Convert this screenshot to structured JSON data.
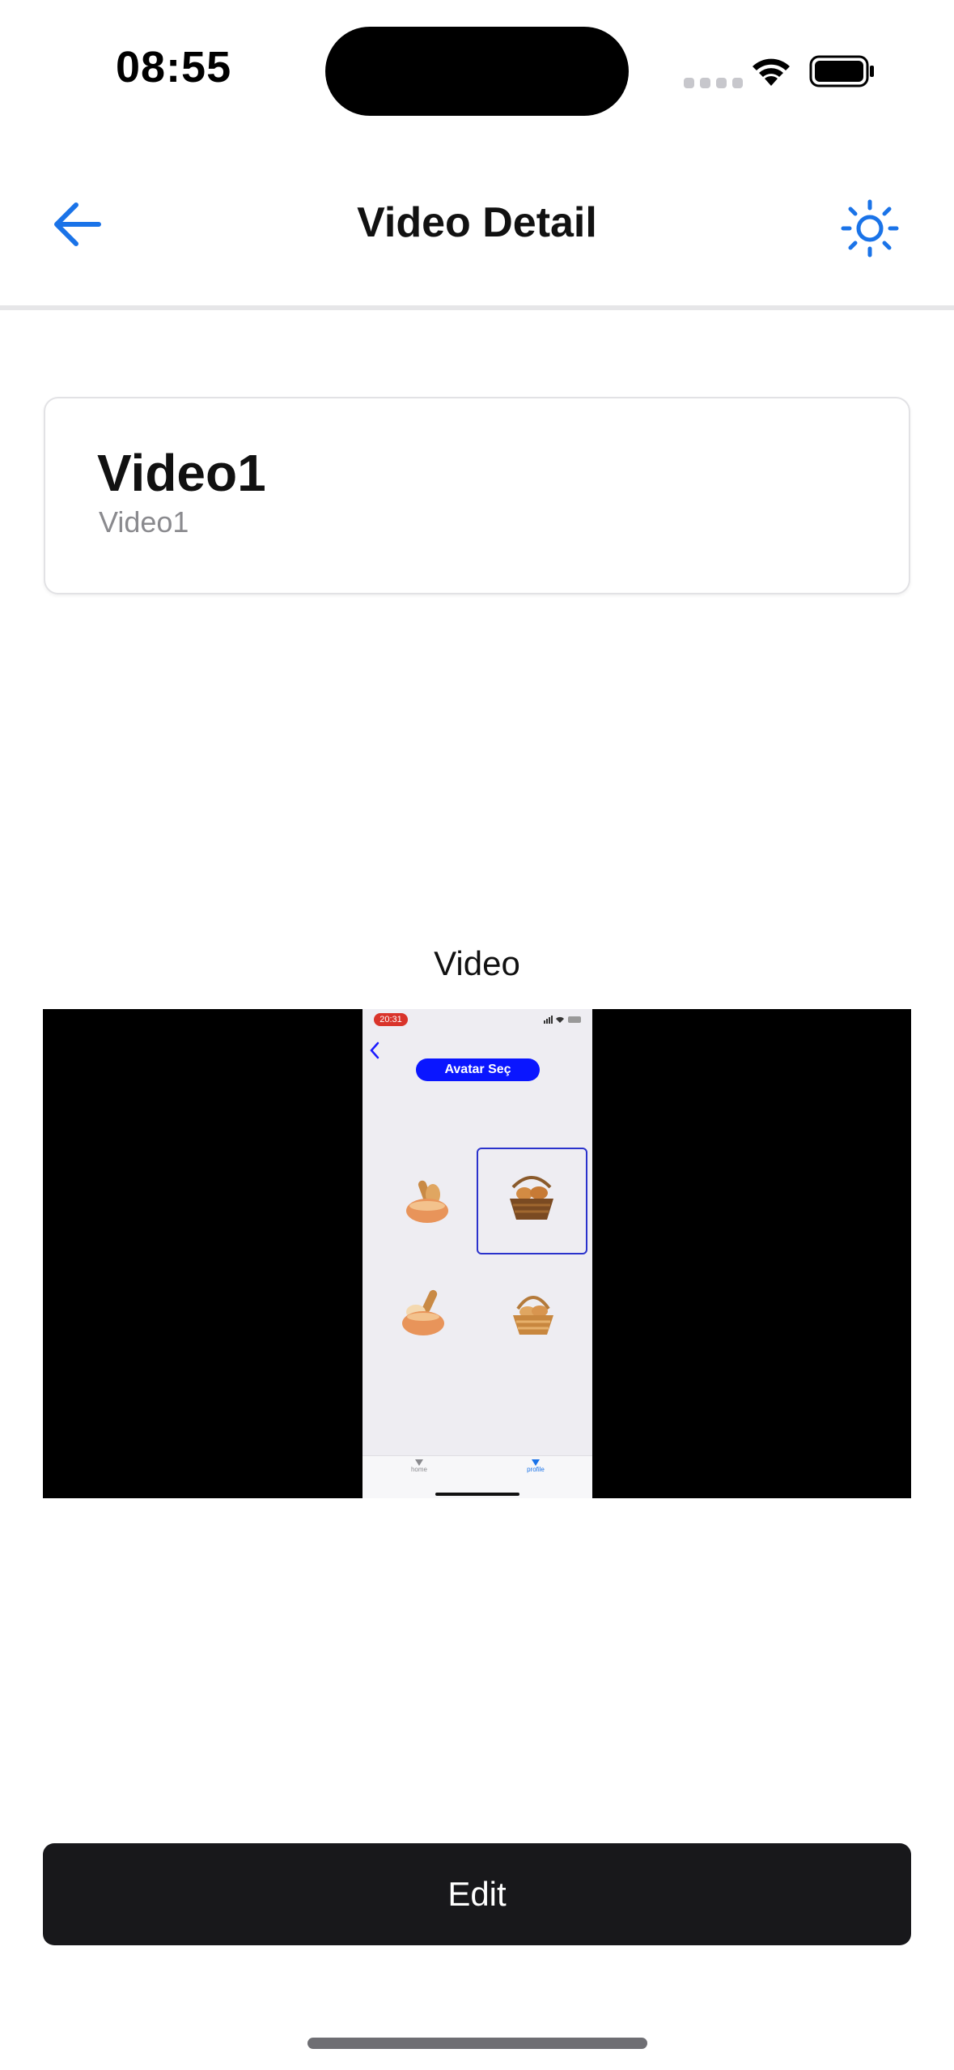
{
  "status_bar": {
    "time": "08:55",
    "icons": [
      "cellular-icon",
      "wifi-icon",
      "battery-icon"
    ]
  },
  "nav": {
    "title": "Video Detail",
    "back_icon": "arrow-left-icon",
    "settings_icon": "sun-icon",
    "accent_color": "#1a73e8"
  },
  "card": {
    "title": "Video1",
    "subtitle": "Video1"
  },
  "video": {
    "label": "Video",
    "preview": {
      "time": "20:31",
      "pill": "Avatar Seç",
      "tabs": [
        "home",
        "profile"
      ],
      "pill_color": "#0a16ff"
    }
  },
  "actions": {
    "edit_label": "Edit"
  }
}
